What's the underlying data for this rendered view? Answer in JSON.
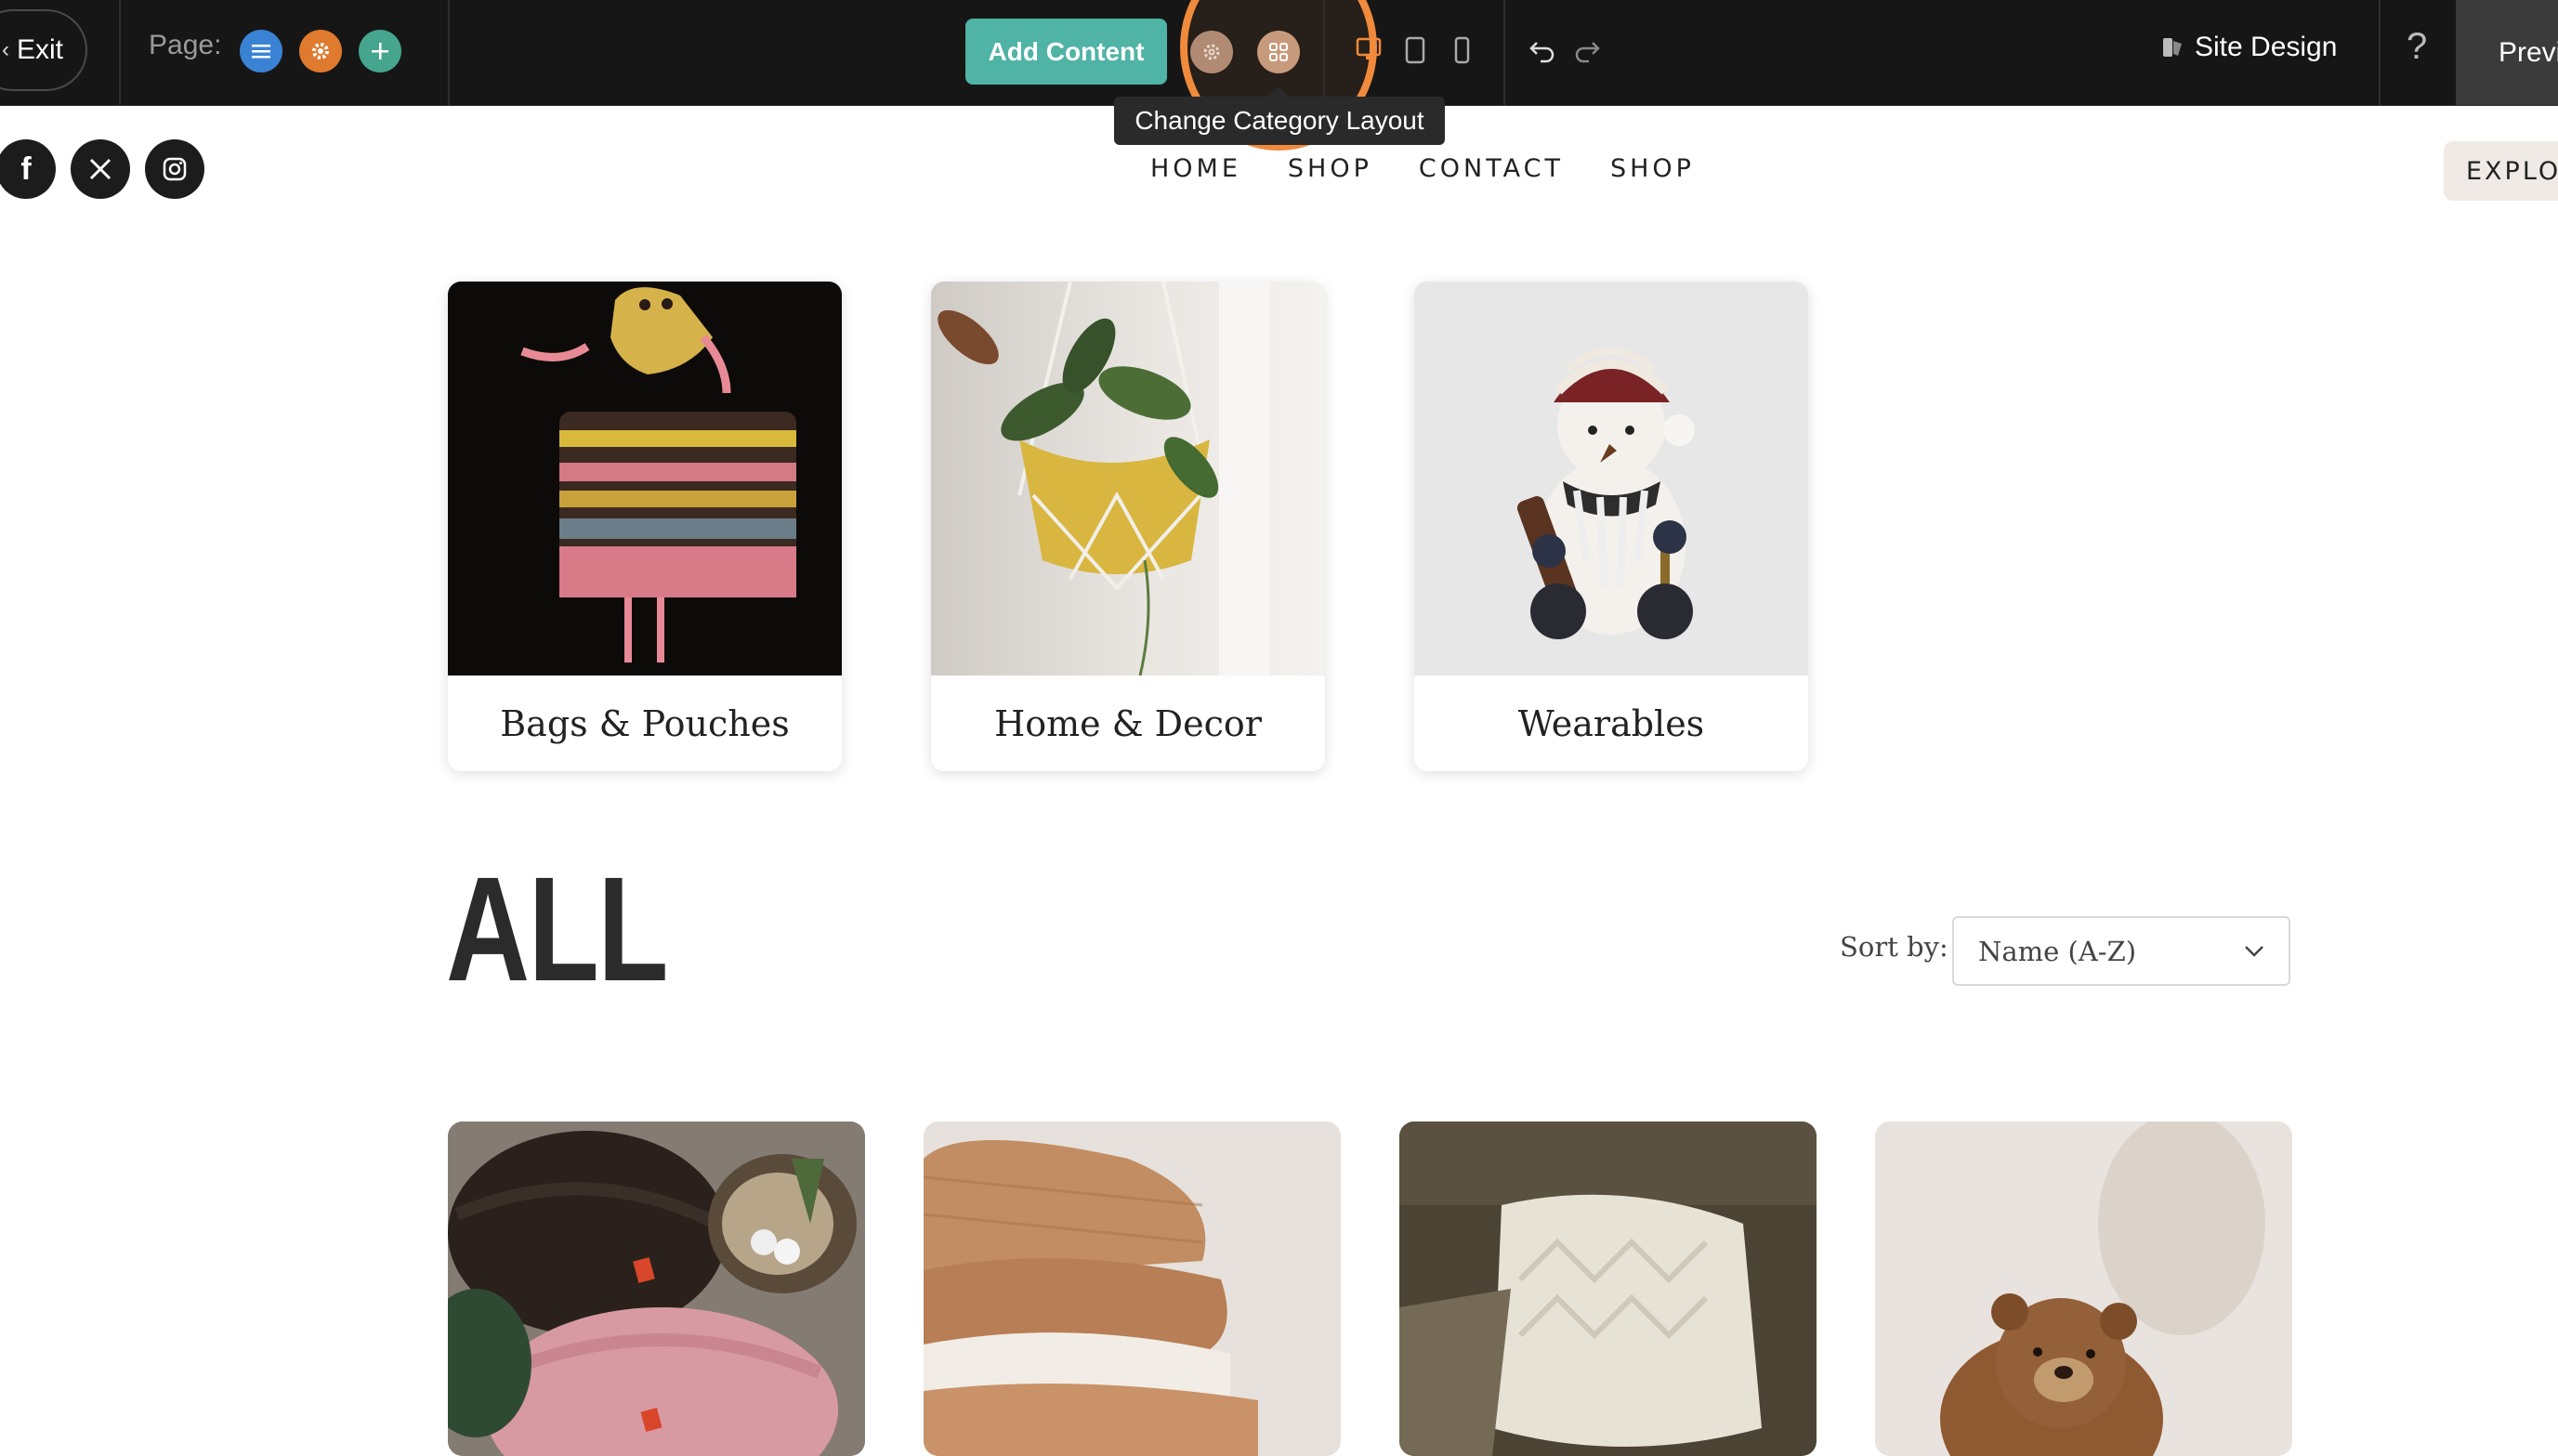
{
  "toolbar": {
    "exit_label": "Exit",
    "page_label": "Page:",
    "add_content_label": "Add Content",
    "tooltip": "Change Category Layout",
    "site_design_label": "Site Design",
    "help_label": "?",
    "preview_label": "Previ"
  },
  "header": {
    "nav": [
      "HOME",
      "SHOP",
      "CONTACT",
      "SHOP"
    ],
    "explore_label": "EXPLOR"
  },
  "categories": [
    {
      "label": "Bags & Pouches"
    },
    {
      "label": "Home & Decor"
    },
    {
      "label": "Wearables"
    }
  ],
  "all_section": {
    "heading": "ALL",
    "sort_label": "Sort by:",
    "sort_value": "Name (A-Z)"
  },
  "colors": {
    "accent_teal": "#4fb3a5",
    "highlight_orange": "#f08a3c",
    "page_icon_blue": "#3a83d4",
    "page_icon_orange": "#e07a2e",
    "page_icon_green": "#46a58f"
  }
}
